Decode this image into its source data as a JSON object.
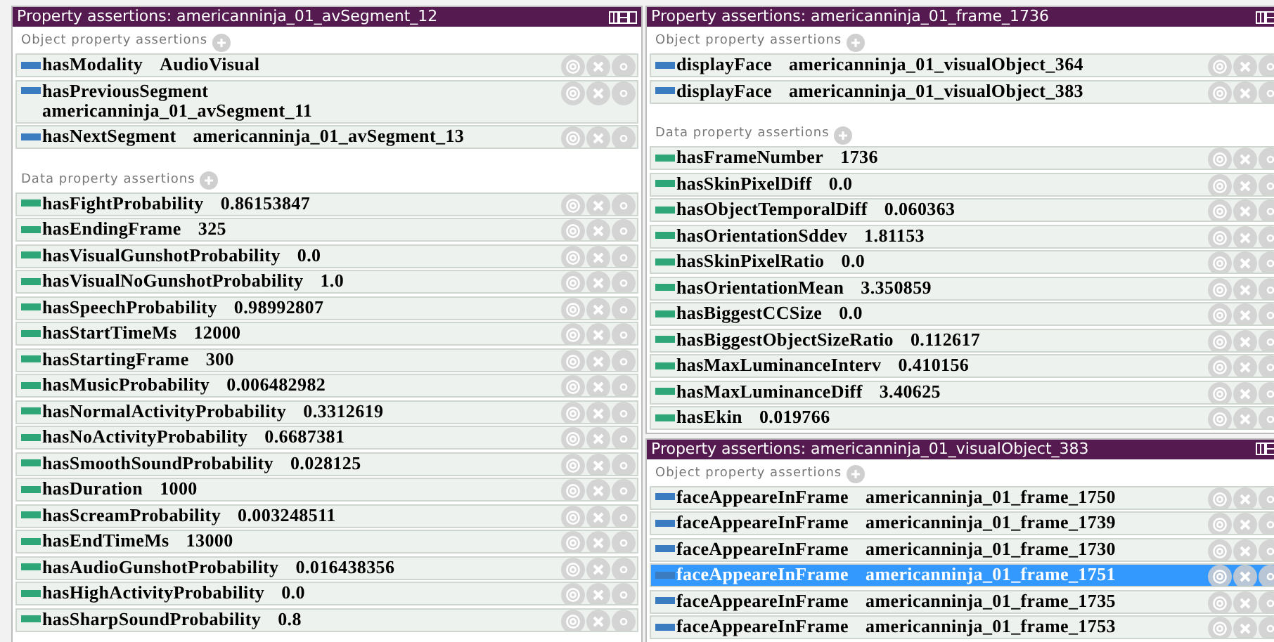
{
  "panels": [
    {
      "title": "Property assertions: americanninja_01_avSegment_12",
      "sections": [
        {
          "heading": "Object property assertions",
          "kind": "object",
          "rows": [
            {
              "property": "hasModality",
              "value": "AudioVisual",
              "selected": false,
              "wrapped": false
            },
            {
              "property": "hasPreviousSegment",
              "value": "americanninja_01_avSegment_11",
              "selected": false,
              "wrapped": true
            },
            {
              "property": "hasNextSegment",
              "value": "americanninja_01_avSegment_13",
              "selected": false,
              "wrapped": false
            }
          ]
        },
        {
          "heading": "Data property assertions",
          "kind": "data",
          "rows": [
            {
              "property": "hasFightProbability",
              "value": "0.86153847",
              "selected": false,
              "wrapped": false
            },
            {
              "property": "hasEndingFrame",
              "value": "325",
              "selected": false,
              "wrapped": false
            },
            {
              "property": "hasVisualGunshotProbability",
              "value": "0.0",
              "selected": false,
              "wrapped": false
            },
            {
              "property": "hasVisualNoGunshotProbability",
              "value": "1.0",
              "selected": false,
              "wrapped": false
            },
            {
              "property": "hasSpeechProbability",
              "value": "0.98992807",
              "selected": false,
              "wrapped": false
            },
            {
              "property": "hasStartTimeMs",
              "value": "12000",
              "selected": false,
              "wrapped": false
            },
            {
              "property": "hasStartingFrame",
              "value": "300",
              "selected": false,
              "wrapped": false
            },
            {
              "property": "hasMusicProbability",
              "value": "0.006482982",
              "selected": false,
              "wrapped": false
            },
            {
              "property": "hasNormalActivityProbability",
              "value": "0.3312619",
              "selected": false,
              "wrapped": false
            },
            {
              "property": "hasNoActivityProbability",
              "value": "0.6687381",
              "selected": false,
              "wrapped": false
            },
            {
              "property": "hasSmoothSoundProbability",
              "value": "0.028125",
              "selected": false,
              "wrapped": false
            },
            {
              "property": "hasDuration",
              "value": "1000",
              "selected": false,
              "wrapped": false
            },
            {
              "property": "hasScreamProbability",
              "value": "0.003248511",
              "selected": false,
              "wrapped": false
            },
            {
              "property": "hasEndTimeMs",
              "value": "13000",
              "selected": false,
              "wrapped": false
            },
            {
              "property": "hasAudioGunshotProbability",
              "value": "0.016438356",
              "selected": false,
              "wrapped": false
            },
            {
              "property": "hasHighActivityProbability",
              "value": "0.0",
              "selected": false,
              "wrapped": false
            },
            {
              "property": "hasSharpSoundProbability",
              "value": "0.8",
              "selected": false,
              "wrapped": false
            }
          ]
        }
      ]
    },
    {
      "title": "Property assertions: americanninja_01_frame_1736",
      "sections": [
        {
          "heading": "Object property assertions",
          "kind": "object",
          "rows": [
            {
              "property": "displayFace",
              "value": "americanninja_01_visualObject_364",
              "selected": false,
              "wrapped": false
            },
            {
              "property": "displayFace",
              "value": "americanninja_01_visualObject_383",
              "selected": false,
              "wrapped": false
            }
          ]
        },
        {
          "heading": "Data property assertions",
          "kind": "data",
          "rows": [
            {
              "property": "hasFrameNumber",
              "value": "1736",
              "selected": false,
              "wrapped": false
            },
            {
              "property": "hasSkinPixelDiff",
              "value": "0.0",
              "selected": false,
              "wrapped": false
            },
            {
              "property": "hasObjectTemporalDiff",
              "value": "0.060363",
              "selected": false,
              "wrapped": false
            },
            {
              "property": "hasOrientationSddev",
              "value": "1.81153",
              "selected": false,
              "wrapped": false
            },
            {
              "property": "hasSkinPixelRatio",
              "value": "0.0",
              "selected": false,
              "wrapped": false
            },
            {
              "property": "hasOrientationMean",
              "value": "3.350859",
              "selected": false,
              "wrapped": false
            },
            {
              "property": "hasBiggestCCSize",
              "value": "0.0",
              "selected": false,
              "wrapped": false
            },
            {
              "property": "hasBiggestObjectSizeRatio",
              "value": "0.112617",
              "selected": false,
              "wrapped": false
            },
            {
              "property": "hasMaxLuminanceInterv",
              "value": "0.410156",
              "selected": false,
              "wrapped": false
            },
            {
              "property": "hasMaxLuminanceDiff",
              "value": "3.40625",
              "selected": false,
              "wrapped": false
            },
            {
              "property": "hasEkin",
              "value": "0.019766",
              "selected": false,
              "wrapped": false
            }
          ]
        }
      ]
    },
    {
      "title": "Property assertions: americanninja_01_visualObject_383",
      "sections": [
        {
          "heading": "Object property assertions",
          "kind": "object",
          "rows": [
            {
              "property": "faceAppeareInFrame",
              "value": "americanninja_01_frame_1750",
              "selected": false,
              "wrapped": false
            },
            {
              "property": "faceAppeareInFrame",
              "value": "americanninja_01_frame_1739",
              "selected": false,
              "wrapped": false
            },
            {
              "property": "faceAppeareInFrame",
              "value": "americanninja_01_frame_1730",
              "selected": false,
              "wrapped": false
            },
            {
              "property": "faceAppeareInFrame",
              "value": "americanninja_01_frame_1751",
              "selected": true,
              "wrapped": false
            },
            {
              "property": "faceAppeareInFrame",
              "value": "americanninja_01_frame_1735",
              "selected": false,
              "wrapped": false
            },
            {
              "property": "faceAppeareInFrame",
              "value": "americanninja_01_frame_1753",
              "selected": false,
              "wrapped": false
            }
          ]
        }
      ]
    }
  ]
}
